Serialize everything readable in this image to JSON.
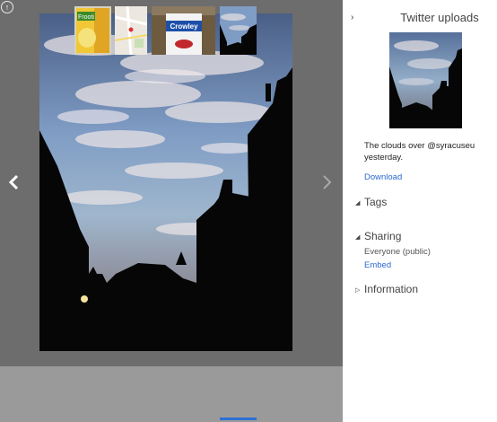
{
  "viewer": {
    "up_icon": "up-arrow-circle-icon",
    "prev_icon": "chevron-left-icon",
    "next_icon": "chevron-right-icon",
    "photo_description": "clouds-over-campus-photo"
  },
  "filmstrip": {
    "thumbnails": [
      {
        "name": "juice-carton-thumbnail"
      },
      {
        "name": "map-thumbnail"
      },
      {
        "name": "crowley-yogurt-thumbnail"
      },
      {
        "name": "clouds-thumbnail",
        "selected": true
      }
    ]
  },
  "panel": {
    "collapse_icon": "chevron-right-small-icon",
    "album_title": "Twitter uploads",
    "caption": "The clouds over @syracuseu yesterday.",
    "download_label": "Download",
    "sections": {
      "tags": {
        "label": "Tags",
        "expanded": true
      },
      "sharing": {
        "label": "Sharing",
        "expanded": true,
        "value": "Everyone (public)",
        "embed_label": "Embed"
      },
      "information": {
        "label": "Information",
        "expanded": false
      }
    }
  },
  "thumb_labels": {
    "juice": "Frooti",
    "yogurt": "Crowley"
  },
  "colors": {
    "viewer_bg": "#6d6d6d",
    "filmstrip_bg": "#9a9a9a",
    "link": "#2b6ad0",
    "selected_bar": "#2d6fd1"
  }
}
